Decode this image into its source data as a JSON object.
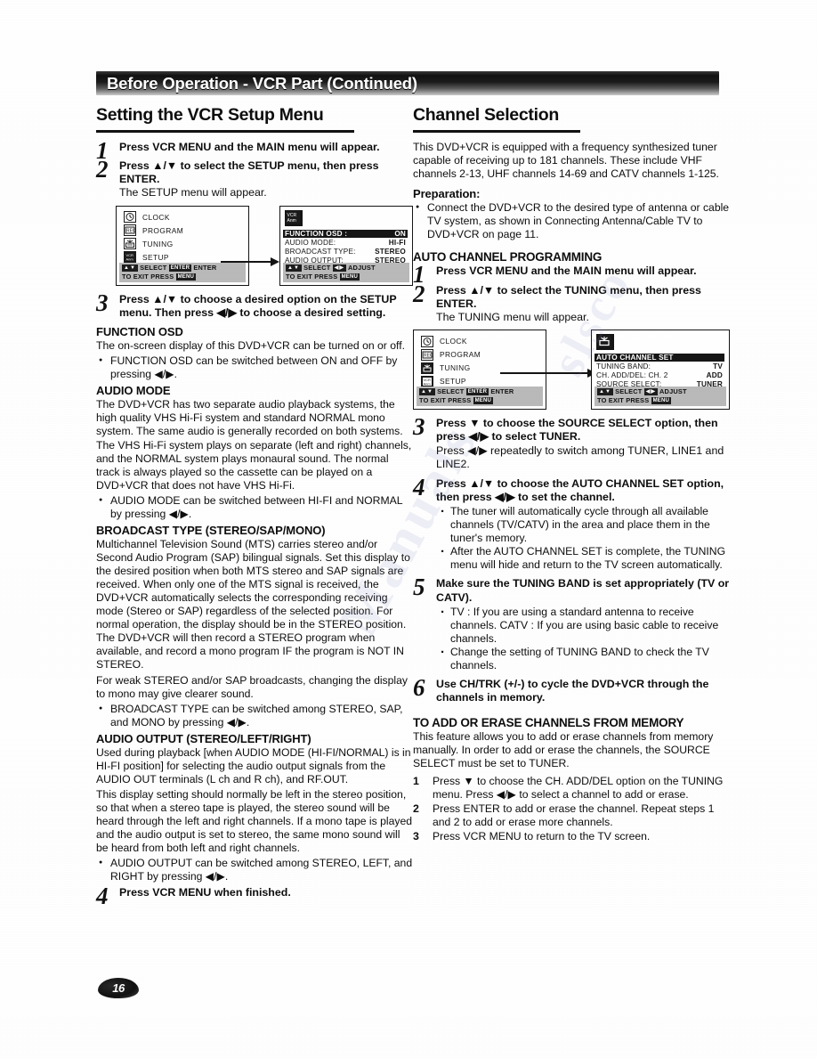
{
  "banner": {
    "title": "Before Operation - VCR Part (Continued)"
  },
  "page": {
    "number": "16"
  },
  "watermark": {
    "text1": "Manuals",
    "text2": "slsco"
  },
  "left": {
    "heading": "Setting the VCR Setup Menu",
    "step1": {
      "num": "1",
      "text": "Press VCR MENU and the MAIN menu will appear."
    },
    "step2": {
      "num": "2",
      "text": "Press ▲/▼ to select the SETUP menu, then press ENTER.",
      "sub": "The SETUP menu will appear."
    },
    "step3": {
      "num": "3",
      "text": "Press ▲/▼ to choose a desired option on the SETUP menu. Then press ◀/▶ to choose a desired setting."
    },
    "step4": {
      "num": "4",
      "text": "Press  VCR MENU when finished."
    },
    "main_menu": {
      "items": [
        {
          "icon": "clock-icon",
          "label": "CLOCK",
          "selected": false
        },
        {
          "icon": "program-rec-icon",
          "label": "PROGRAM",
          "selected": false
        },
        {
          "icon": "tuning-icon",
          "label": "TUNING",
          "selected": false
        },
        {
          "icon": "setup-icon",
          "label": "SETUP",
          "selected": true
        }
      ],
      "footer_line1": "SELECT",
      "footer_key1": "ENTER",
      "footer_line1b": "ENTER",
      "footer_line2": "TO EXIT PRESS",
      "footer_key2": "MENU"
    },
    "setup_menu": {
      "icon": "setup-icon",
      "rows": [
        {
          "label": "FUNCTION OSD :",
          "value": "ON",
          "highlighted": true
        },
        {
          "label": "AUDIO MODE:",
          "value": "HI-FI",
          "highlighted": false
        },
        {
          "label": "BROADCAST TYPE:",
          "value": "STEREO",
          "highlighted": false
        },
        {
          "label": "AUDIO OUTPUT:",
          "value": "STEREO",
          "highlighted": false
        }
      ],
      "footer_line1": "SELECT",
      "footer_line1b": "ADJUST",
      "footer_line2": "TO  EXIT  PRESS",
      "footer_key2": "MENU"
    },
    "function_osd": {
      "title": "FUNCTION OSD",
      "body": "The on-screen display of this DVD+VCR can be turned on or off.",
      "bullet": "FUNCTION OSD can be switched between ON and OFF by pressing ◀/▶."
    },
    "audio_mode": {
      "title": "AUDIO MODE",
      "body": "The DVD+VCR has two separate audio playback systems, the high quality VHS Hi-Fi system and standard NORMAL mono system. The same audio is generally recorded on both systems. The VHS Hi-Fi system plays on separate (left and right) channels, and the NORMAL system plays monaural sound. The normal track is always played so the cassette can be played on a DVD+VCR that does not have VHS Hi-Fi.",
      "bullet": "AUDIO MODE can be switched between HI-FI and NORMAL by pressing ◀/▶."
    },
    "broadcast_type": {
      "title": "BROADCAST TYPE (STEREO/SAP/MONO)",
      "body1": "Multichannel Television Sound (MTS) carries stereo and/or Second Audio Program (SAP) bilingual signals. Set this display to the desired position when both MTS stereo and SAP signals are received. When only one of the MTS signal is received, the DVD+VCR automatically selects the corresponding receiving mode (Stereo or SAP) regardless of the selected position. For normal operation, the display should be in the STEREO position. The DVD+VCR will then record a STEREO program when available, and record a mono program IF the program is NOT IN STEREO.",
      "body2": "For weak STEREO and/or SAP broadcasts, changing the display to mono may give clearer sound.",
      "bullet": "BROADCAST TYPE can be switched among STEREO, SAP, and MONO by pressing ◀/▶."
    },
    "audio_output": {
      "title": "AUDIO OUTPUT (STEREO/LEFT/RIGHT)",
      "body1": "Used during playback [when AUDIO MODE (HI-FI/NORMAL) is in HI-FI position] for selecting the audio output signals from the AUDIO OUT terminals (L ch and R ch), and RF.OUT.",
      "body2": "This display setting should normally be left in the stereo position, so that when a stereo tape is played, the stereo sound will be heard through the left and right channels. If a mono tape is played and the audio output is set to stereo, the same mono sound will be heard from both left and right channels.",
      "bullet": "AUDIO OUTPUT can be switched among STEREO, LEFT, and RIGHT by pressing ◀/▶."
    }
  },
  "right": {
    "heading": "Channel Selection",
    "intro": "This DVD+VCR is equipped with a frequency synthesized tuner capable of receiving up to 181 channels. These include VHF channels 2-13, UHF channels 14-69 and CATV channels 1-125.",
    "preparation": {
      "title": "Preparation:",
      "bullet": "Connect the DVD+VCR to the desired type of antenna or cable TV system, as shown in Connecting Antenna/Cable TV to DVD+VCR on page 11."
    },
    "auto_heading": "AUTO CHANNEL PROGRAMMING",
    "step1": {
      "num": "1",
      "text": "Press VCR MENU and the MAIN menu will appear."
    },
    "step2": {
      "num": "2",
      "text": "Press ▲/▼ to select the TUNING menu, then press ENTER.",
      "sub": "The TUNING menu will appear."
    },
    "step3": {
      "num": "3",
      "text": "Press ▼ to choose the SOURCE SELECT option, then press ◀/▶ to select TUNER.",
      "sub": "Press ◀/▶ repeatedly to switch among TUNER, LINE1 and LINE2."
    },
    "step4": {
      "num": "4",
      "text": "Press ▲/▼ to choose the AUTO CHANNEL SET option, then press ◀/▶ to set the channel.",
      "dots": [
        "The tuner will automatically cycle through all available channels (TV/CATV) in the area and place them in the tuner's memory.",
        "After the AUTO CHANNEL SET is complete, the TUNING menu will hide and return to the TV screen automatically."
      ]
    },
    "step5": {
      "num": "5",
      "text": "Make sure the TUNING BAND is set appropriately (TV or CATV).",
      "dots": [
        "TV : If you are using a standard antenna to receive channels. CATV : If you are using basic cable to receive channels.",
        "Change the setting of TUNING BAND to check the TV channels."
      ]
    },
    "step6": {
      "num": "6",
      "text": "Use CH/TRK (+/-) to cycle the DVD+VCR through the channels in memory."
    },
    "main_menu": {
      "items": [
        {
          "icon": "clock-icon",
          "label": "CLOCK",
          "selected": false
        },
        {
          "icon": "program-rec-icon",
          "label": "PROGRAM",
          "selected": false
        },
        {
          "icon": "tuning-icon",
          "label": "TUNING",
          "selected": true
        },
        {
          "icon": "setup-icon",
          "label": "SETUP",
          "selected": false
        }
      ],
      "footer_line1": "SELECT",
      "footer_key1": "ENTER",
      "footer_line1b": "ENTER",
      "footer_line2": "TO EXIT PRESS",
      "footer_key2": "MENU"
    },
    "tuning_menu": {
      "icon": "tuning-icon",
      "title_row": "AUTO CHANNEL SET",
      "rows": [
        {
          "label": "TUNING BAND:",
          "value": "TV"
        },
        {
          "label": "CH.   ADD/DEL: CH. 2",
          "value": "ADD"
        },
        {
          "label": "SOURCE  SELECT:",
          "value": "TUNER"
        }
      ],
      "footer_line1": "SELECT",
      "footer_line1b": "ADJUST",
      "footer_line2": "TO  EXIT  PRESS",
      "footer_key2": "MENU"
    },
    "add_erase": {
      "title": "TO ADD OR ERASE CHANNELS FROM MEMORY",
      "body": "This feature allows you to add or erase channels from memory manually. In order to add or erase the channels, the SOURCE SELECT must be set to TUNER.",
      "items": [
        {
          "n": "1",
          "text": "Press ▼ to choose the CH. ADD/DEL option on the TUNING menu. Press ◀/▶ to select a channel to add or erase."
        },
        {
          "n": "2",
          "text": "Press ENTER to add or erase the channel. Repeat steps 1 and 2 to add or erase more channels."
        },
        {
          "n": "3",
          "text": "Press VCR MENU to return to the TV screen."
        }
      ]
    }
  }
}
